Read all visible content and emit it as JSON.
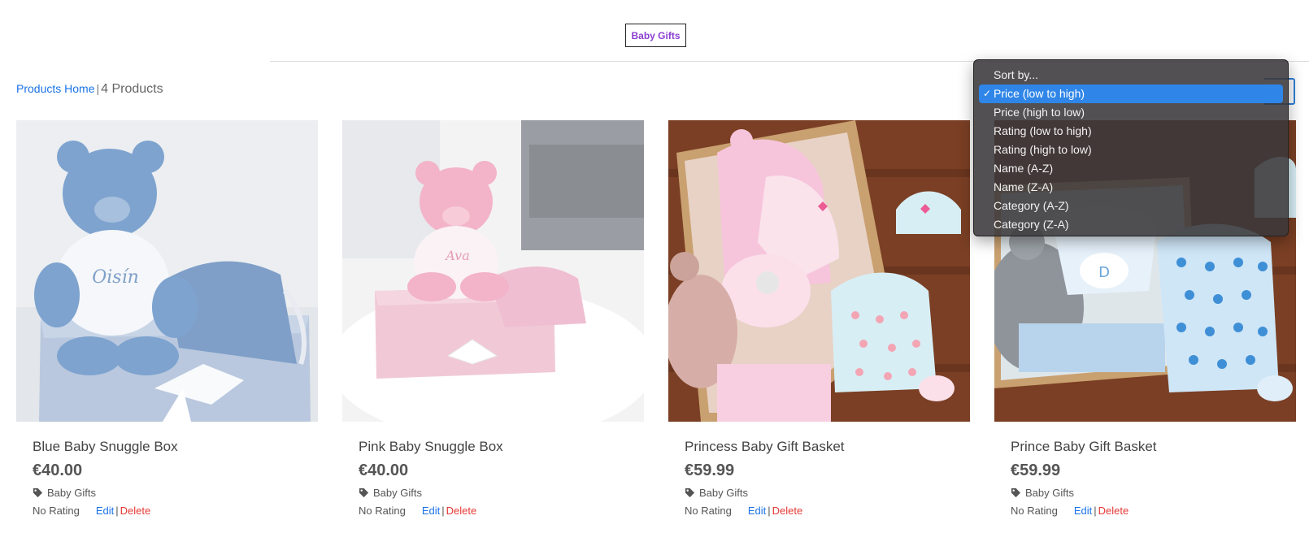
{
  "category_badge": "Baby Gifts",
  "summary": {
    "home_link": "Products Home",
    "separator": "|",
    "count_text": "4 Products"
  },
  "sort": {
    "options": [
      {
        "label": "Sort by..."
      },
      {
        "label": "Price (low to high)",
        "selected": true
      },
      {
        "label": "Price (high to low)"
      },
      {
        "label": "Rating (low to high)"
      },
      {
        "label": "Rating (high to low)"
      },
      {
        "label": "Name (A-Z)"
      },
      {
        "label": "Name (Z-A)"
      },
      {
        "label": "Category (A-Z)"
      },
      {
        "label": "Category (Z-A)"
      }
    ],
    "check_mark": "✓"
  },
  "products": [
    {
      "name": "Blue Baby Snuggle Box",
      "price": "€40.00",
      "category": "Baby Gifts",
      "rating": "No Rating",
      "edit": "Edit",
      "delete": "Delete"
    },
    {
      "name": "Pink Baby Snuggle Box",
      "price": "€40.00",
      "category": "Baby Gifts",
      "rating": "No Rating",
      "edit": "Edit",
      "delete": "Delete"
    },
    {
      "name": "Princess Baby Gift Basket",
      "price": "€59.99",
      "category": "Baby Gifts",
      "rating": "No Rating",
      "edit": "Edit",
      "delete": "Delete"
    },
    {
      "name": "Prince Baby Gift Basket",
      "price": "€59.99",
      "category": "Baby Gifts",
      "rating": "No Rating",
      "edit": "Edit",
      "delete": "Delete"
    }
  ],
  "image_text": {
    "bear_blue": "Oisín",
    "bear_pink": "Ava"
  },
  "colors": {
    "badge_text": "#8a3fd1",
    "link": "#1a73e8",
    "delete": "#e53935",
    "select_highlight": "#2f86e8"
  },
  "icons": {
    "category": "tag-icon",
    "selected": "checkmark-icon"
  }
}
